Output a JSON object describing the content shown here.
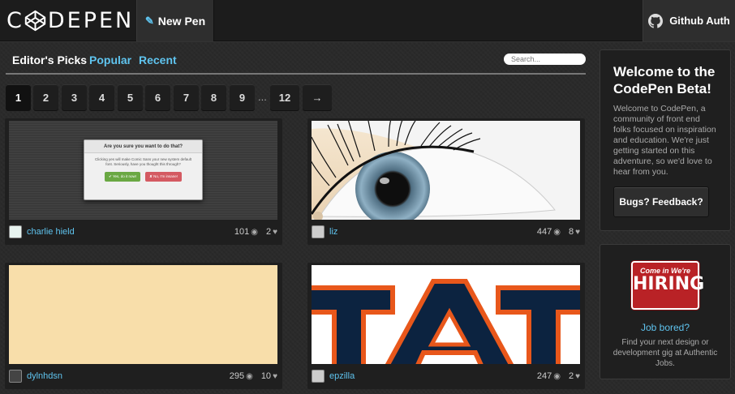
{
  "header": {
    "logo_text": "C DEPEN",
    "new_pen_label": "New Pen",
    "github_label": "Github Auth"
  },
  "tabs": [
    "Editor's Picks",
    "Popular",
    "Recent"
  ],
  "search": {
    "placeholder": "Search..."
  },
  "pagination": {
    "pages": [
      "1",
      "2",
      "3",
      "4",
      "5",
      "6",
      "7",
      "8",
      "9"
    ],
    "ellipsis": "...",
    "last": "12",
    "next": "→",
    "current": "1"
  },
  "pens": [
    {
      "user": "charlie hield",
      "views": "101",
      "hearts": "2",
      "dialog": {
        "title": "Are you sure you want to do that?",
        "body": "Clicking yes will make Comic Sans your new system default font. Seriously, have you thought this through?",
        "yes": "✔ Yes, do it now!",
        "no": "✘ No, I'm insane!"
      }
    },
    {
      "user": "liz",
      "views": "447",
      "hearts": "8"
    },
    {
      "user": "dylnhdsn",
      "views": "295",
      "hearts": "10"
    },
    {
      "user": "epzilla",
      "views": "247",
      "hearts": "2"
    }
  ],
  "sidebar": {
    "welcome_title": "Welcome to the CodePen Beta!",
    "welcome_text": "Welcome to CodePen, a community of front end folks focused on inspiration and education. We're just getting started on this adventure, so we'd love to hear from you.",
    "feedback_label": "Bugs? Feedback?",
    "hiring_sign_top": "Come in  We're",
    "hiring_sign_main": "HIRING",
    "job_link": "Job bored?",
    "job_text": "Find your next design or development gig at Authentic Jobs."
  },
  "colors": {
    "accent": "#5fc4ef",
    "background": "#2a2a2a",
    "hiring_red": "#b92226"
  }
}
